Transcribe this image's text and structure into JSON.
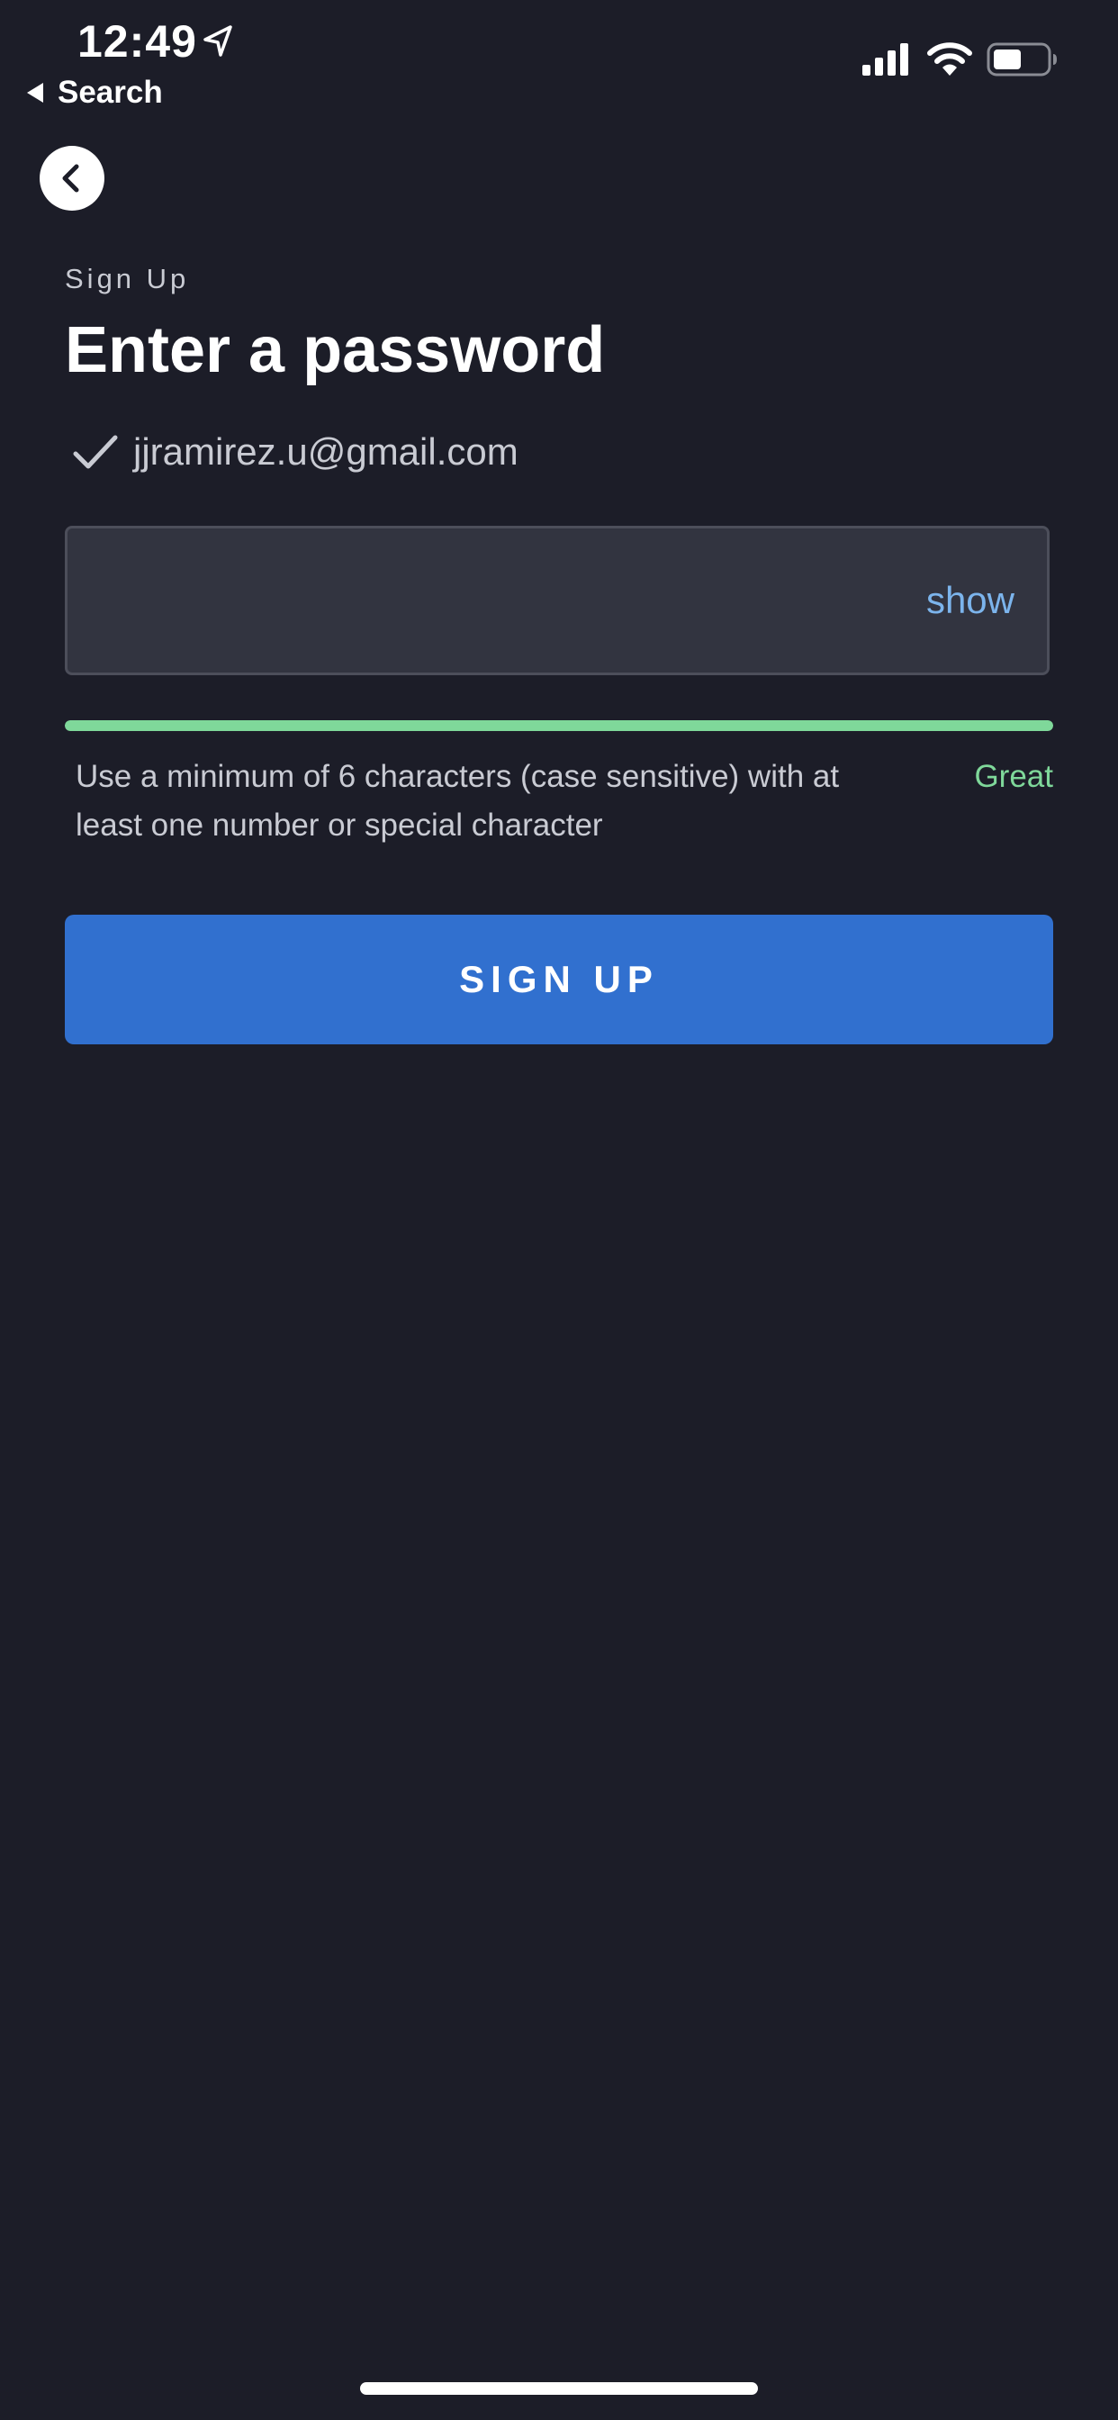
{
  "status_bar": {
    "time": "12:49",
    "back_app_label": "Search"
  },
  "header": {
    "eyebrow": "Sign Up",
    "title": "Enter a password"
  },
  "account": {
    "email": "jjramirez.u@gmail.com"
  },
  "password_field": {
    "value": "",
    "show_label": "show"
  },
  "strength": {
    "level": 1.0,
    "label": "Great",
    "hint": "Use a minimum of 6 characters (case sensitive) with at least one number or special character"
  },
  "actions": {
    "signup_label": "SIGN UP"
  },
  "colors": {
    "background": "#1c1d28",
    "accent": "#3170cf",
    "strength_great": "#7fd89a",
    "link": "#7cb4ec"
  },
  "icons": {
    "status_location": "location-arrow-icon",
    "status_signal": "cellular-signal-icon",
    "status_wifi": "wifi-icon",
    "status_battery": "battery-icon",
    "back": "chevron-left-icon",
    "verified": "checkmark-icon"
  }
}
